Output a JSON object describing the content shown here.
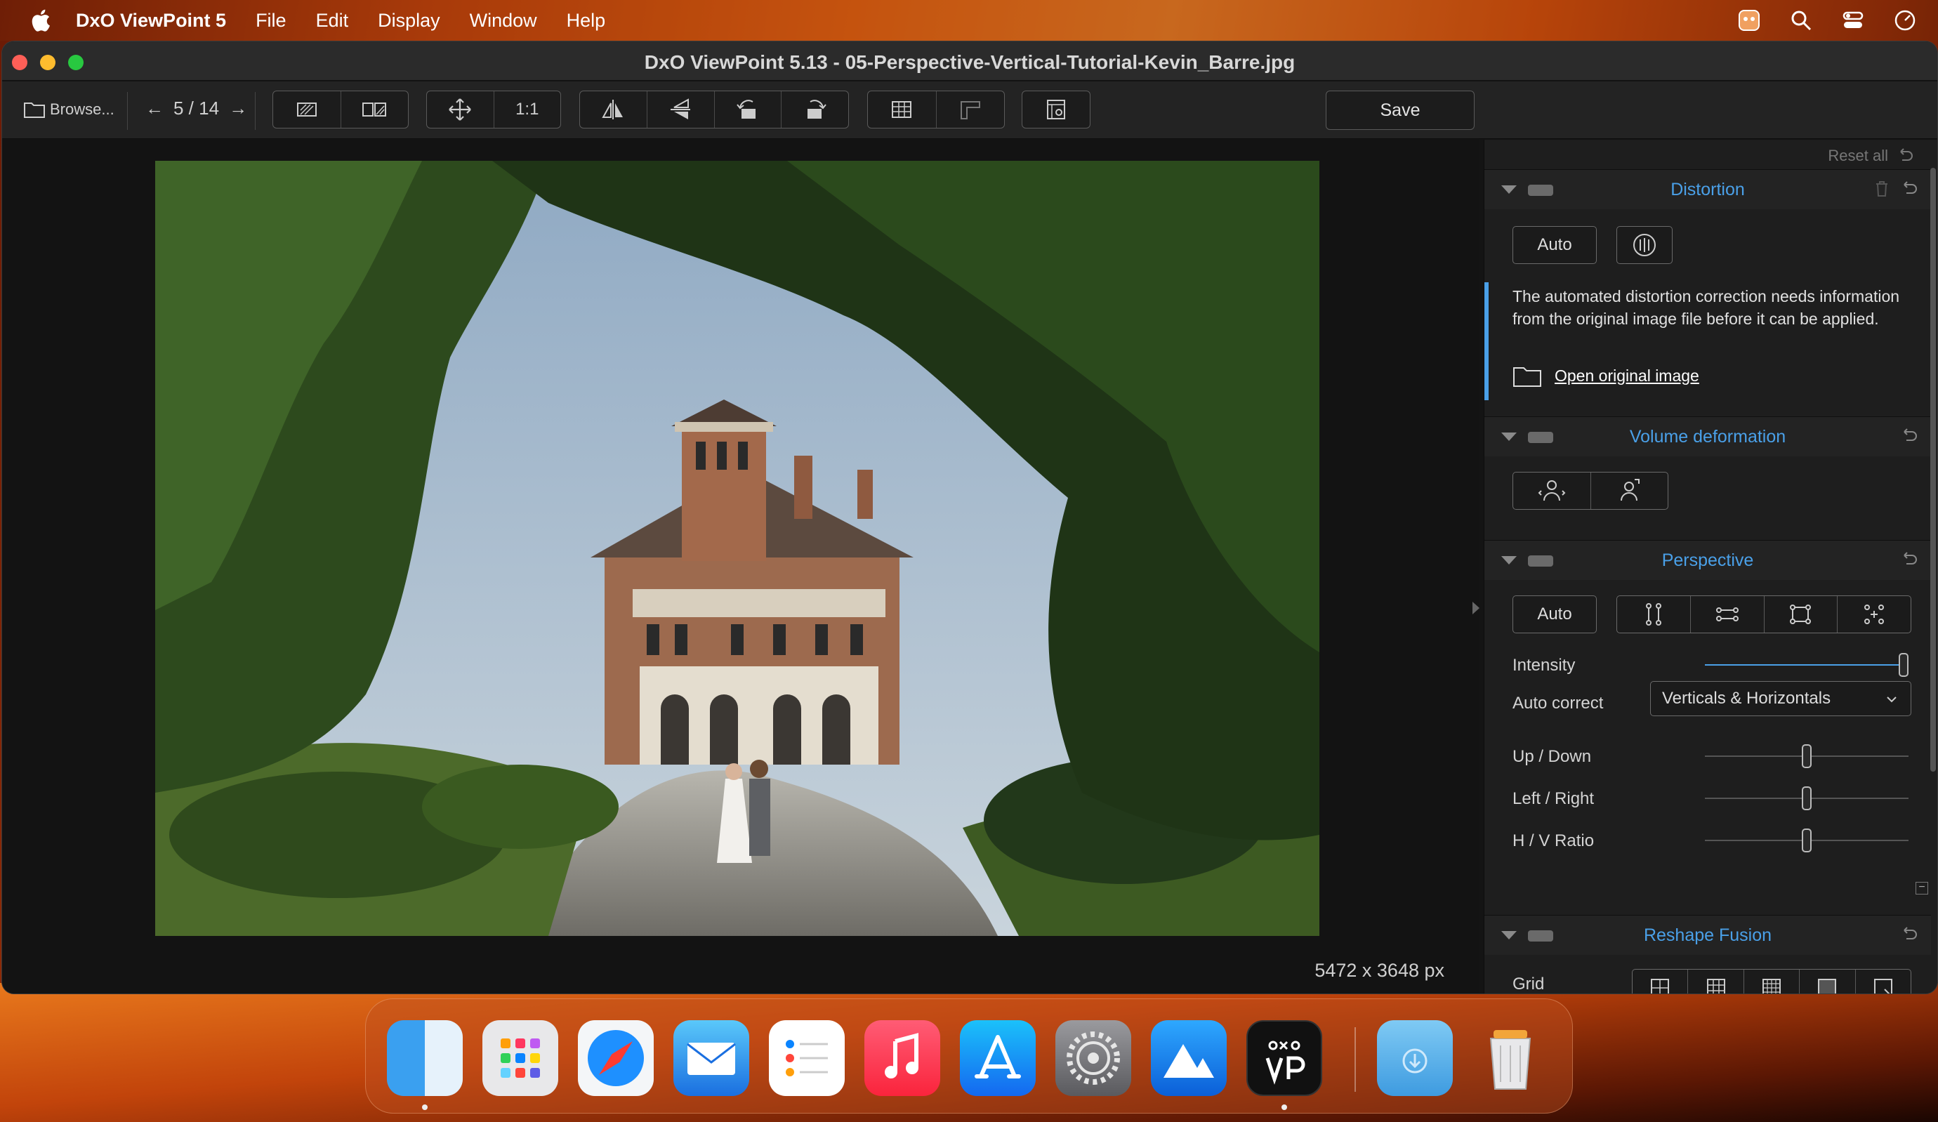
{
  "menubar": {
    "app_name": "DxO ViewPoint 5",
    "items": [
      "File",
      "Edit",
      "Display",
      "Window",
      "Help"
    ]
  },
  "window": {
    "title": "DxO ViewPoint 5.13 - 05-Perspective-Vertical-Tutorial-Kevin_Barre.jpg"
  },
  "toolbar": {
    "browse_label": "Browse...",
    "page_indicator": "5 / 14",
    "zoom_label": "1:1",
    "save_label": "Save"
  },
  "viewer": {
    "dimensions": "5472 x 3648 px"
  },
  "panel": {
    "reset_all": "Reset all",
    "distortion": {
      "title": "Distortion",
      "auto_label": "Auto",
      "message": "The automated distortion correction needs information from the original image file before it can be applied.",
      "open_original": "Open original image"
    },
    "volume_deformation": {
      "title": "Volume deformation"
    },
    "perspective": {
      "title": "Perspective",
      "auto_label": "Auto",
      "intensity_label": "Intensity",
      "intensity_value": 1.0,
      "auto_correct_label": "Auto correct",
      "auto_correct_value": "Verticals & Horizontals",
      "sliders": [
        {
          "label": "Up / Down",
          "value": 0.5
        },
        {
          "label": "Left / Right",
          "value": 0.5
        },
        {
          "label": "H / V Ratio",
          "value": 0.5
        }
      ]
    },
    "reshape_fusion": {
      "title": "Reshape Fusion",
      "grid_label": "Grid"
    }
  },
  "dock": {
    "apps": [
      "Finder",
      "Launchpad",
      "Safari",
      "Mail",
      "Reminders",
      "Music",
      "App Store",
      "System Settings",
      "Affinity",
      "DxO ViewPoint",
      "Downloads",
      "Trash"
    ]
  },
  "colors": {
    "accent": "#4aa0e8",
    "panel_bg": "#1e1e1e",
    "toolbar_bg": "#232323"
  }
}
